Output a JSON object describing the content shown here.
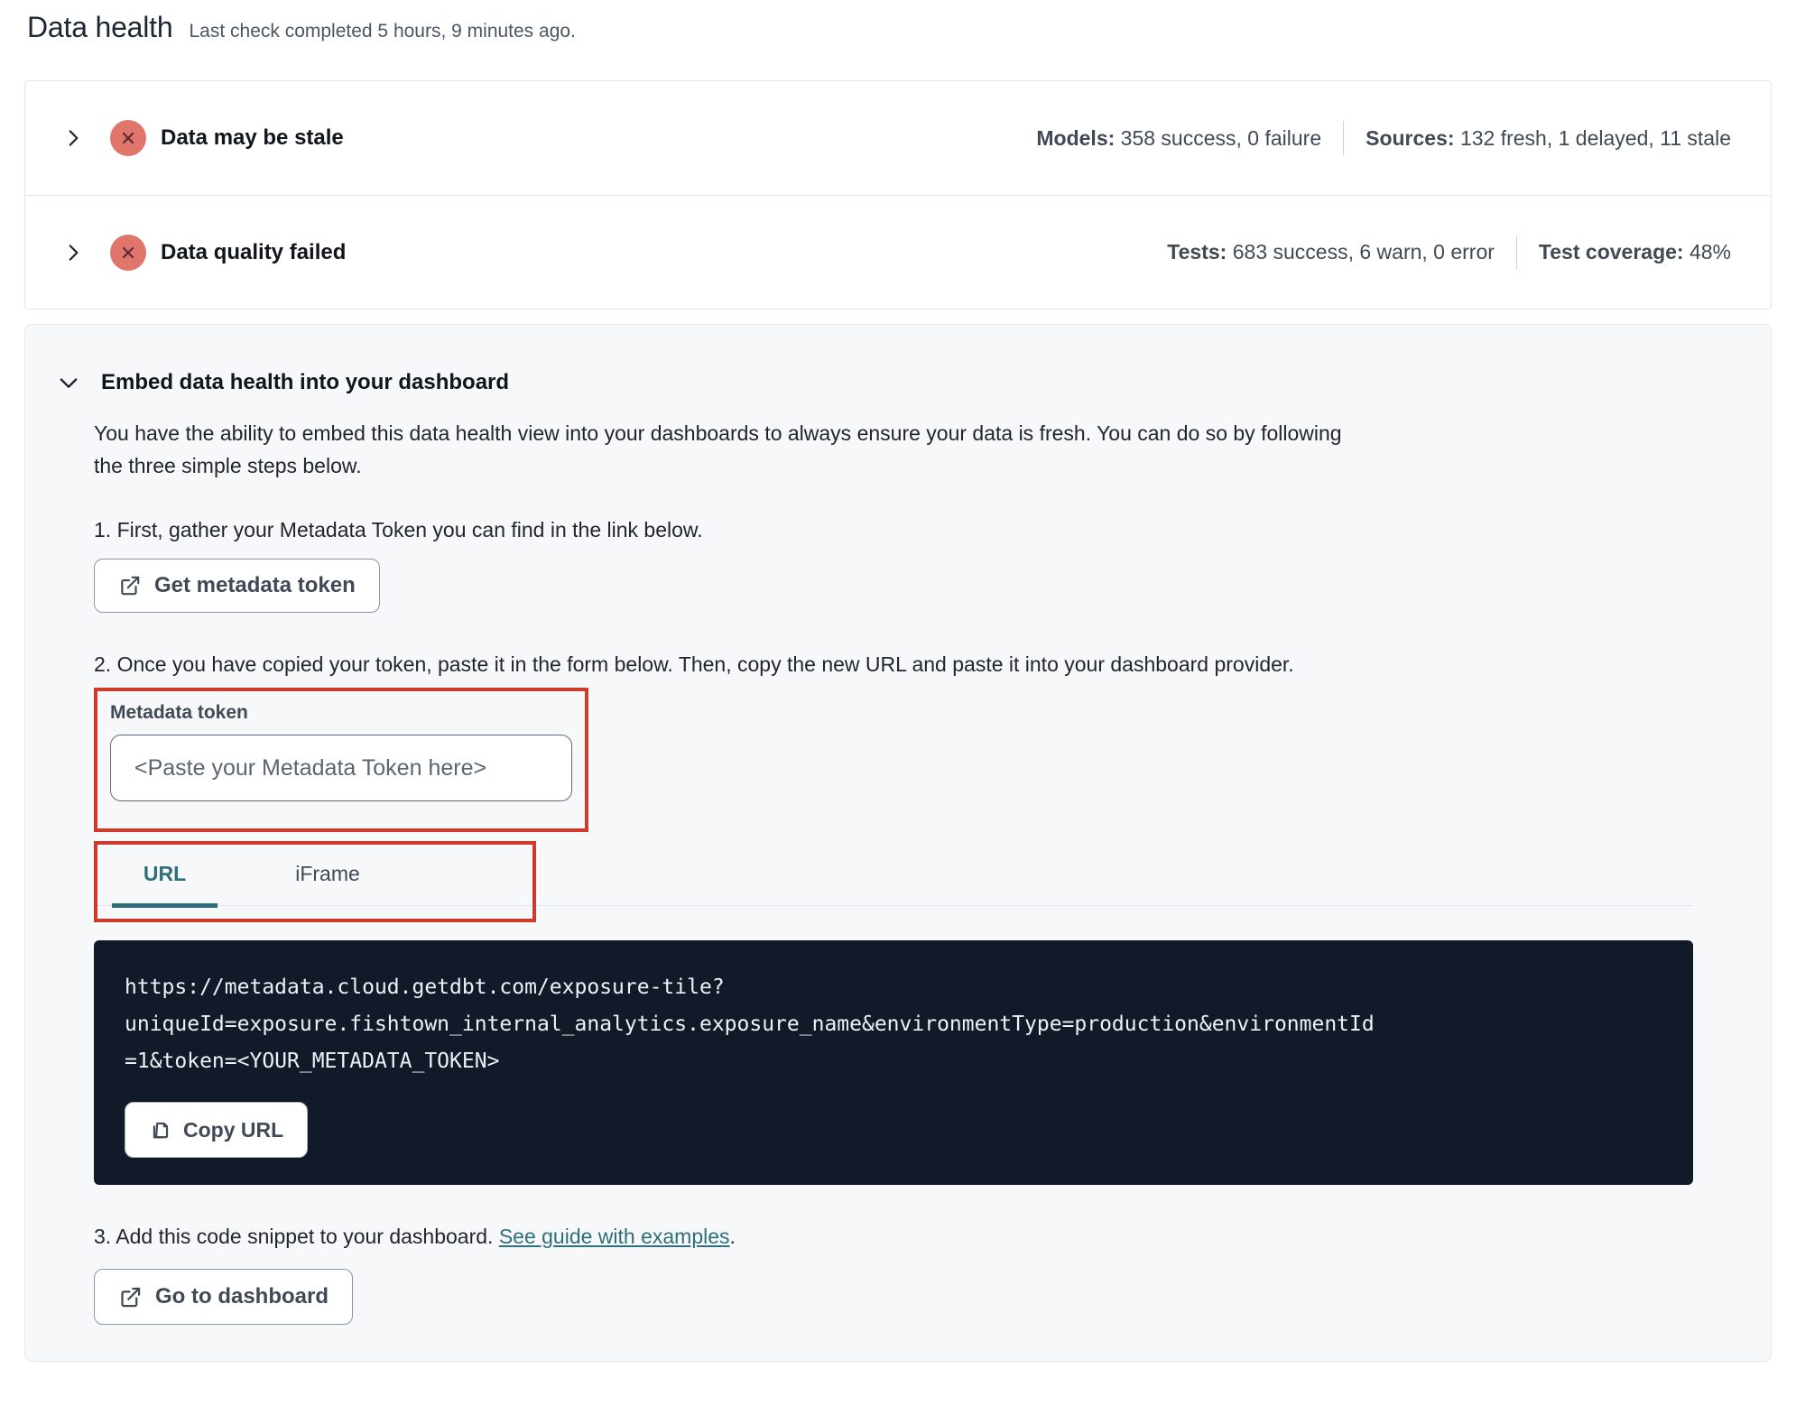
{
  "page": {
    "title": "Data health",
    "subtitle": "Last check completed 5 hours, 9 minutes ago."
  },
  "status_rows": [
    {
      "title": "Data may be stale",
      "stats": [
        {
          "label": "Models:",
          "value": "358 success, 0 failure"
        },
        {
          "label": "Sources:",
          "value": "132 fresh, 1 delayed, 11 stale"
        }
      ]
    },
    {
      "title": "Data quality failed",
      "stats": [
        {
          "label": "Tests:",
          "value": "683 success, 6 warn, 0 error"
        },
        {
          "label": "Test coverage:",
          "value": "48%"
        }
      ]
    }
  ],
  "embed": {
    "title": "Embed data health into your dashboard",
    "description": "You have the ability to embed this data health view into your dashboards to always ensure your data is fresh. You can do so by following the three simple steps below.",
    "step1": {
      "text": "1. First, gather your Metadata Token you can find in the link below.",
      "button_label": "Get metadata token"
    },
    "step2": {
      "text": "2. Once you have copied your token, paste it in the form below. Then, copy the new URL and paste it into your dashboard provider.",
      "token_label": "Metadata token",
      "token_placeholder": "<Paste your Metadata Token here>",
      "tabs": [
        {
          "label": "URL",
          "active": true
        },
        {
          "label": "iFrame",
          "active": false
        }
      ],
      "code_url_lines": [
        "https://metadata.cloud.getdbt.com/exposure-tile?",
        "uniqueId=exposure.fishtown_internal_analytics.exposure_name&environmentType=production&environmentId",
        "=1&token=<YOUR_METADATA_TOKEN>"
      ],
      "copy_button_label": "Copy URL"
    },
    "step3": {
      "text_before_link": "3. Add this code snippet to your dashboard. ",
      "link_text": "See guide with examples",
      "text_after_link": ".",
      "button_label": "Go to dashboard"
    }
  },
  "icons": {
    "row_expander": "chevron-right",
    "section_expander": "chevron-down",
    "status_error": "x-circle",
    "button_external": "external-link",
    "copy": "copy"
  },
  "colors": {
    "accent_teal": "#2e6f7a",
    "error_badge_bg": "#e0756c",
    "error_badge_x": "#5f2e35",
    "annotation_red": "#cf3b28",
    "code_background": "#121a29"
  }
}
